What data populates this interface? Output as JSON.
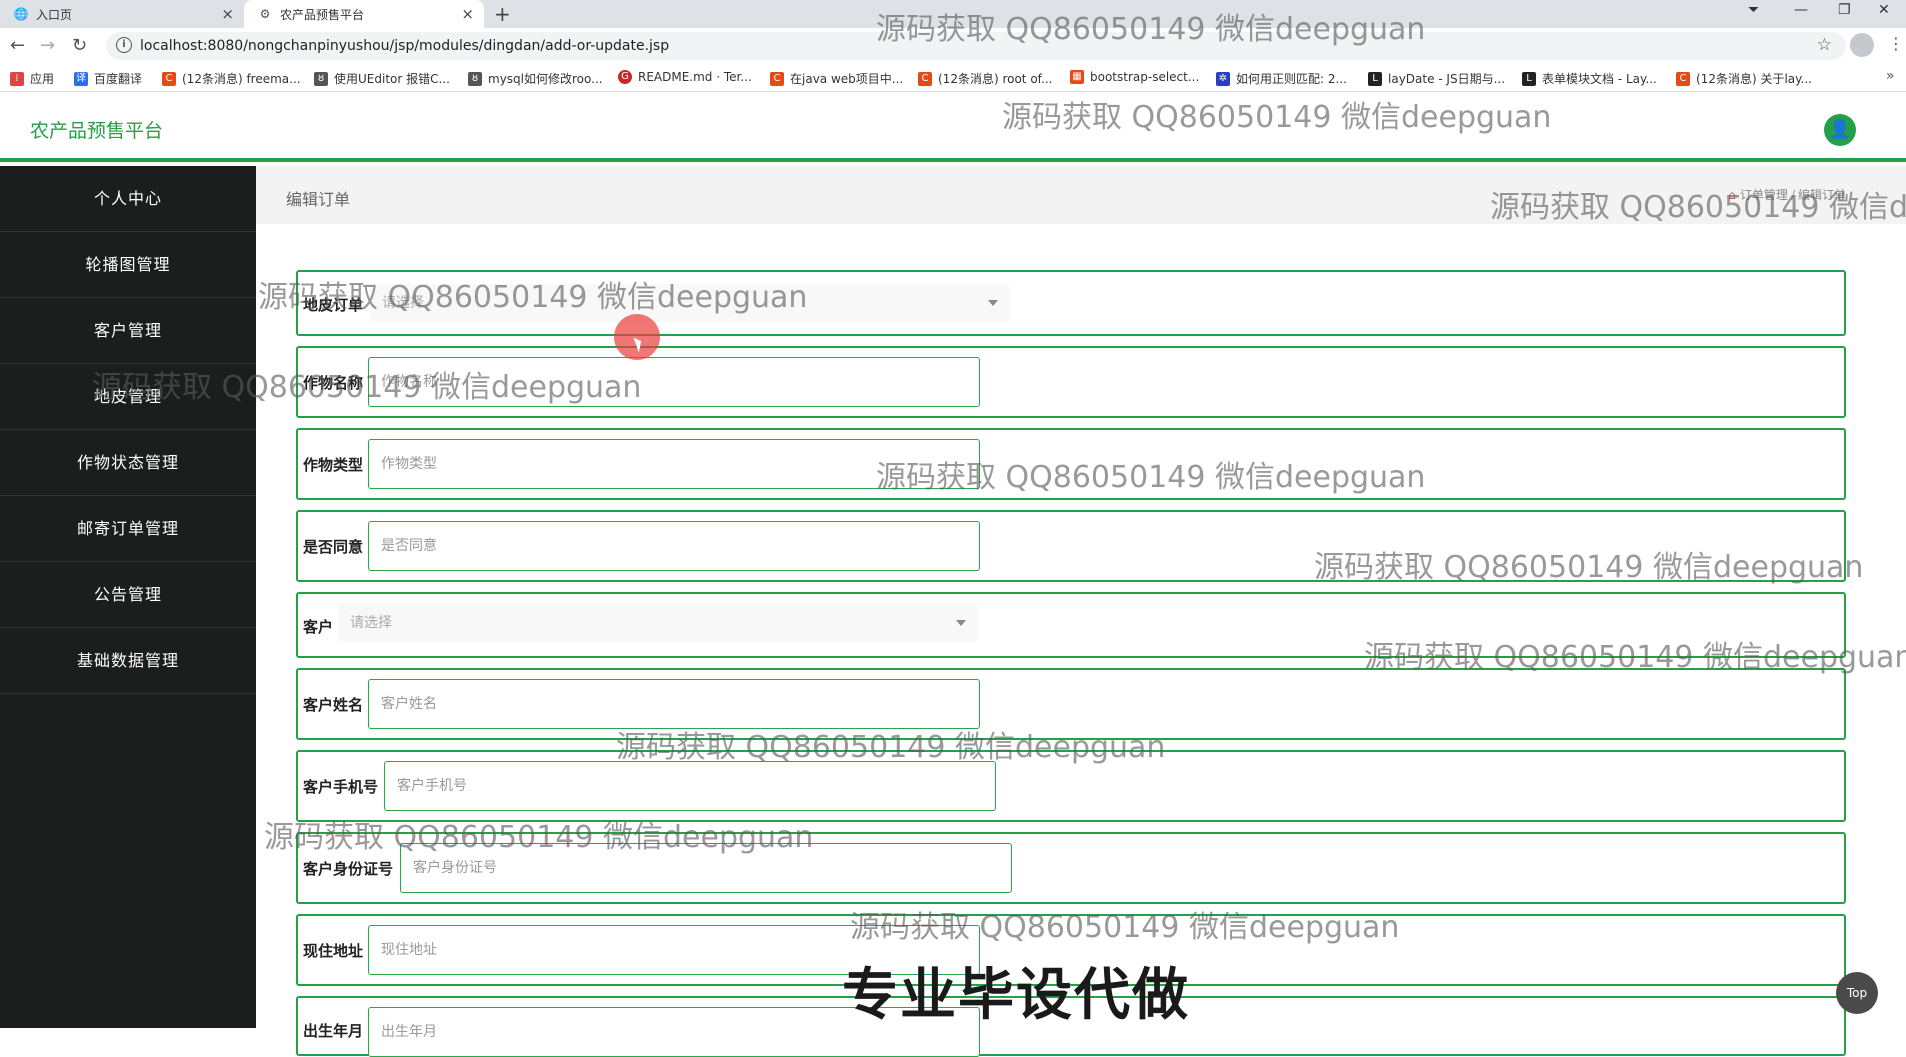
{
  "browser": {
    "tabs": [
      {
        "title": "入口页",
        "active": false
      },
      {
        "title": "农产品预售平台",
        "active": true
      }
    ],
    "url": "localhost:8080/nongchanpinyushou/jsp/modules/dingdan/add-or-update.jsp",
    "bookmarks": [
      {
        "label": "应用",
        "color": "#d44"
      },
      {
        "label": "百度翻译",
        "color": "#2a6ee8"
      },
      {
        "label": "(12条消息) freema...",
        "color": "#e64a19"
      },
      {
        "label": "使用UEditor 报错C...",
        "color": "#555"
      },
      {
        "label": "mysql如何修改roo...",
        "color": "#555"
      },
      {
        "label": "README.md · Ter...",
        "color": "#c62828"
      },
      {
        "label": "在java web项目中...",
        "color": "#e64a19"
      },
      {
        "label": "(12条消息) root of...",
        "color": "#e64a19"
      },
      {
        "label": "bootstrap-select...",
        "color": "#e64a19"
      },
      {
        "label": "如何用正则匹配: 2...",
        "color": "#2a3cc8"
      },
      {
        "label": "layDate - JS日期与...",
        "color": "#222"
      },
      {
        "label": "表单模块文档 - Lay...",
        "color": "#222"
      },
      {
        "label": "(12条消息) 关于lay...",
        "color": "#e64a19"
      }
    ]
  },
  "app": {
    "title": "农产品预售平台",
    "avatar_icon": "user-icon"
  },
  "sidebar": {
    "items": [
      {
        "label": "个人中心"
      },
      {
        "label": "轮播图管理"
      },
      {
        "label": "客户管理"
      },
      {
        "label": "地皮管理"
      },
      {
        "label": "作物状态管理"
      },
      {
        "label": "邮寄订单管理"
      },
      {
        "label": "公告管理"
      },
      {
        "label": "基础数据管理"
      }
    ]
  },
  "page": {
    "title": "编辑订单",
    "breadcrumb": [
      "订单管理",
      "编辑订单"
    ]
  },
  "form": {
    "fields": [
      {
        "label": "地皮订单",
        "type": "select",
        "placeholder": "请选择"
      },
      {
        "label": "作物名称",
        "type": "input",
        "placeholder": "作物名称"
      },
      {
        "label": "作物类型",
        "type": "input",
        "placeholder": "作物类型"
      },
      {
        "label": "是否同意",
        "type": "input",
        "placeholder": "是否同意"
      },
      {
        "label": "客户",
        "type": "select",
        "placeholder": "请选择"
      },
      {
        "label": "客户姓名",
        "type": "input",
        "placeholder": "客户姓名"
      },
      {
        "label": "客户手机号",
        "type": "input",
        "placeholder": "客户手机号"
      },
      {
        "label": "客户身份证号",
        "type": "input",
        "placeholder": "客户身份证号"
      },
      {
        "label": "现住地址",
        "type": "input",
        "placeholder": "现住地址"
      },
      {
        "label": "出生年月",
        "type": "input",
        "placeholder": "出生年月"
      }
    ]
  },
  "top_button": "Top",
  "watermark": {
    "text": "源码获取 QQ86050149 微信deepguan",
    "banner": "专业毕设代做"
  },
  "colors": {
    "accent": "#24a148",
    "sidebar_bg": "#1c1d1d"
  }
}
